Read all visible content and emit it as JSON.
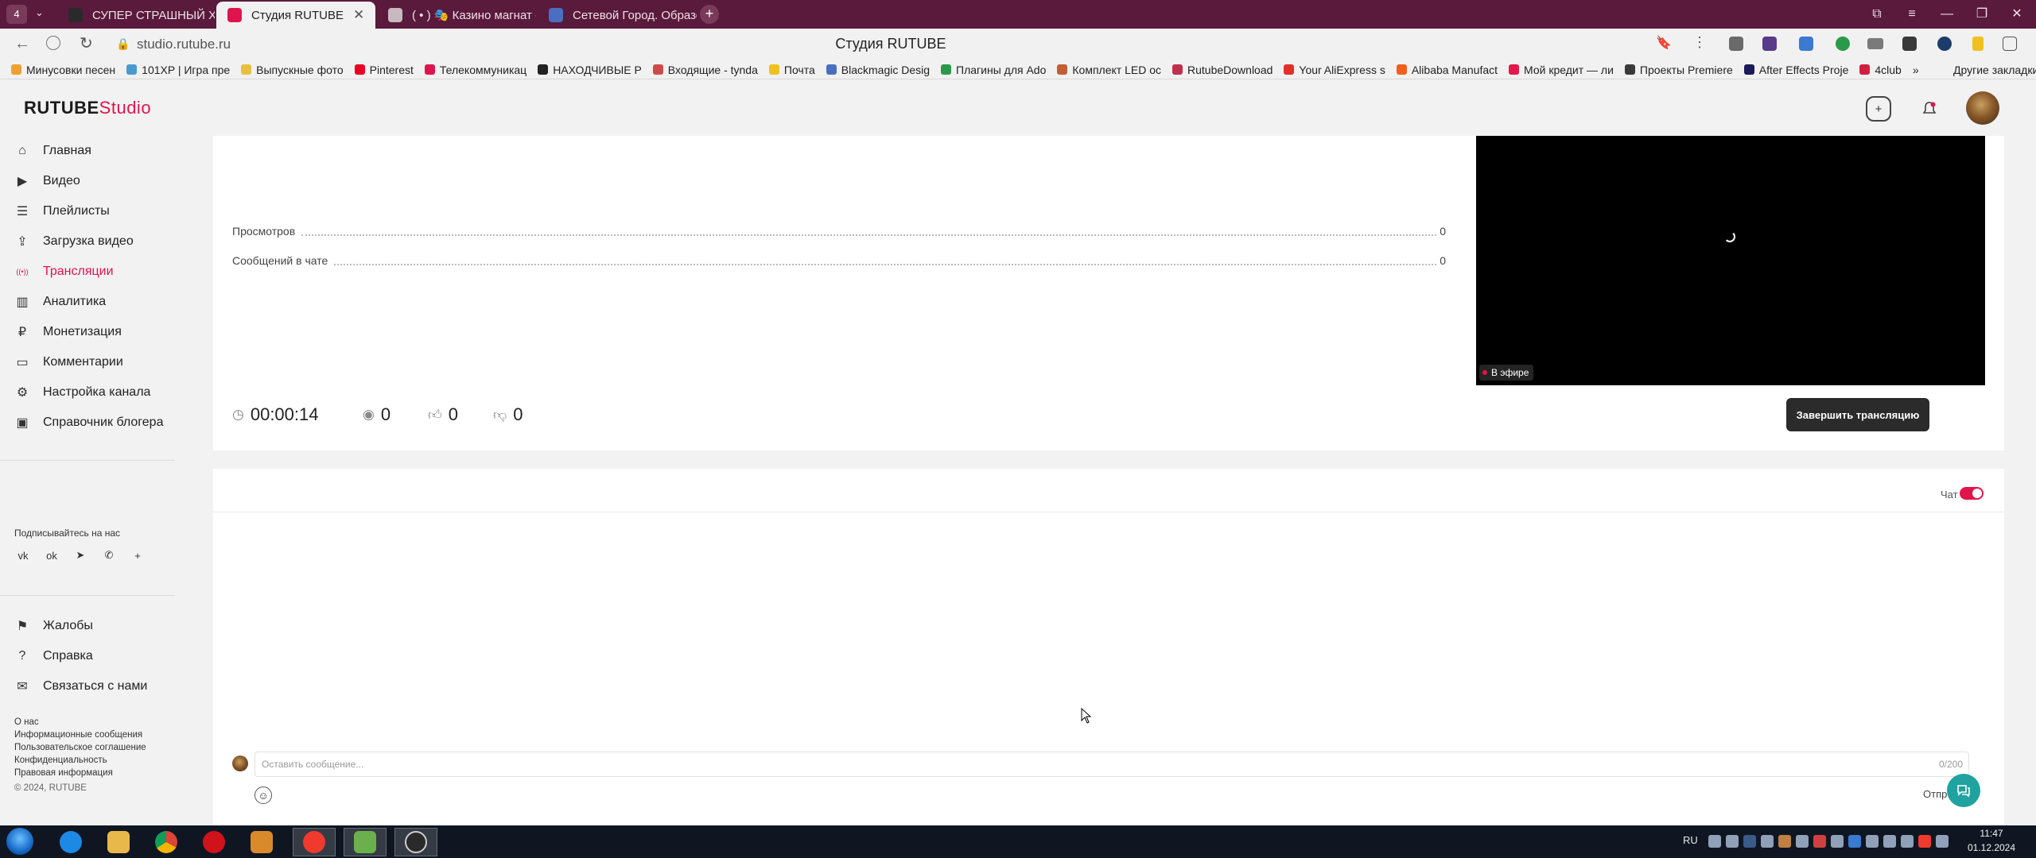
{
  "browser": {
    "tab_counter": "4",
    "tabs": [
      {
        "label": "СУПЕР СТРАШНЫЙ ХОР"
      },
      {
        "label": "Студия RUTUBE"
      },
      {
        "label": "( • ) 🎭 Казино магнат - R"
      },
      {
        "label": "Сетевой Город. Образова"
      }
    ],
    "title": "Студия RUTUBE",
    "url": "studio.rutube.ru",
    "bookmarks": [
      "Минусовки песен",
      "101XP | Игра пре",
      "Выпускные фото",
      "Pinterest",
      "Телекоммуникац",
      "НАХОДЧИВЫЕ Р",
      "Входящие - tynda",
      "Почта",
      "Blackmagic Desig",
      "Плагины для Ado",
      "Комплект LED ос",
      "RutubeDownload",
      "Your AliExpress s",
      "Alibaba Manufact",
      "Мой кредит — ли",
      "Проекты Premiere",
      "After Effects Proje",
      "4club"
    ],
    "other_bookmarks": "Другие закладки"
  },
  "header": {
    "logo_brand": "RUTUBE",
    "logo_product": "Studio"
  },
  "sidebar": {
    "items": [
      {
        "label": "Главная",
        "icon": "home-icon"
      },
      {
        "label": "Видео",
        "icon": "video-icon"
      },
      {
        "label": "Плейлисты",
        "icon": "playlist-icon"
      },
      {
        "label": "Загрузка видео",
        "icon": "upload-icon"
      },
      {
        "label": "Трансляции",
        "icon": "broadcast-icon",
        "active": true
      },
      {
        "label": "Аналитика",
        "icon": "analytics-icon"
      },
      {
        "label": "Монетизация",
        "icon": "monetization-icon"
      },
      {
        "label": "Комментарии",
        "icon": "comments-icon"
      },
      {
        "label": "Настройка канала",
        "icon": "settings-icon"
      },
      {
        "label": "Справочник блогера",
        "icon": "guide-icon"
      }
    ],
    "follow_label": "Подписывайтесь на нас",
    "socials": [
      "vk",
      "ok",
      "telegram",
      "viber",
      "+"
    ],
    "bottom_items": [
      {
        "label": "Жалобы",
        "icon": "flag-icon"
      },
      {
        "label": "Справка",
        "icon": "help-icon"
      },
      {
        "label": "Связаться с нами",
        "icon": "mail-icon"
      }
    ],
    "footer_links": [
      "О нас",
      "Информационные сообщения",
      "Пользовательское соглашение",
      "Конфиденциальность",
      "Правовая информация"
    ],
    "copyright": "© 2024, RUTUBE"
  },
  "stream": {
    "stats": [
      {
        "label": "Просмотров",
        "value": "0"
      },
      {
        "label": "Сообщений в чате",
        "value": "0"
      }
    ],
    "live_badge": "В эфире",
    "duration": "00:00:14",
    "viewers": "0",
    "likes": "0",
    "dislikes": "0",
    "end_button": "Завершить трансляцию"
  },
  "chat": {
    "label": "Чат",
    "enabled": true,
    "input_placeholder": "Оставить сообщение...",
    "counter": "0/200",
    "send_button": "Отпр"
  },
  "taskbar": {
    "lang": "RU",
    "time": "11:47",
    "date": "01.12.2024"
  },
  "colors": {
    "accent": "#e0144c",
    "tabbar": "#5a1a3c",
    "help_fab": "#1fa2a0"
  }
}
